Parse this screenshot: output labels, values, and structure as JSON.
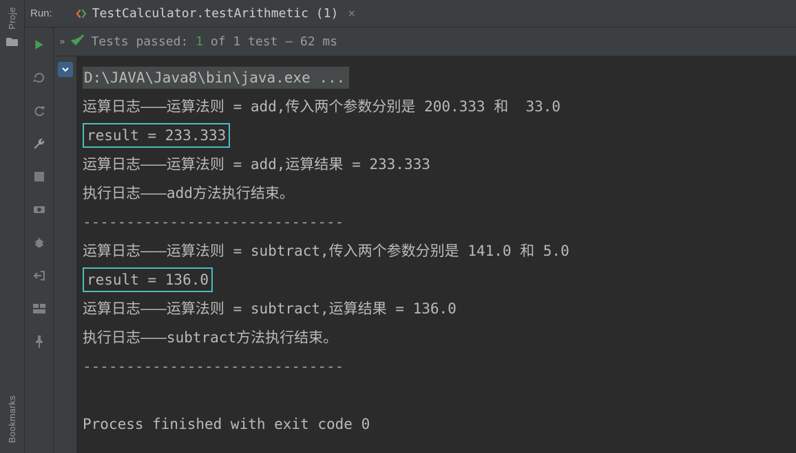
{
  "leftRail": {
    "topLabel": "Proje",
    "bottomLabel": "Bookmarks"
  },
  "tabbar": {
    "runLabel": "Run:",
    "tabTitle": "TestCalculator.testArithmetic (1)"
  },
  "status": {
    "chev": "»",
    "prefix": "Tests passed:",
    "passedCount": "1",
    "suffix": "of 1 test – 62 ms"
  },
  "console": {
    "cmd": "D:\\JAVA\\Java8\\bin\\java.exe ...",
    "l1": "运算日志———运算法则 = add,传入两个参数分别是 200.333 和  33.0",
    "hl1": "result = 233.333",
    "l2": "运算日志———运算法则 = add,运算结果 = 233.333",
    "l3": "执行日志———add方法执行结束。",
    "div1": "------------------------------",
    "l4": "运算日志———运算法则 = subtract,传入两个参数分别是 141.0 和 5.0",
    "hl2": "result = 136.0",
    "l5": "运算日志———运算法则 = subtract,运算结果 = 136.0",
    "l6": "执行日志———subtract方法执行结束。",
    "div2": "------------------------------",
    "exit": "Process finished with exit code 0"
  }
}
